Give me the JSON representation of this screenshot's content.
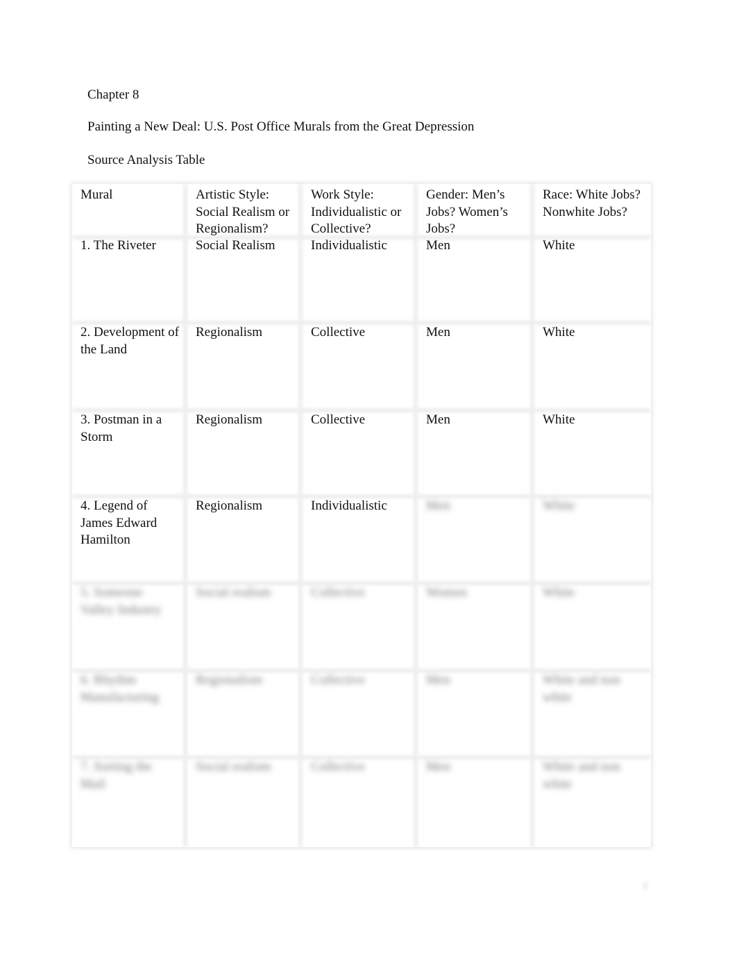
{
  "document": {
    "chapter": "Chapter 8",
    "title": "Painting a New Deal: U.S. Post Office Murals from the Great Depression",
    "subtitle": "Source Analysis Table"
  },
  "table": {
    "headers": [
      "Mural",
      "Artistic Style: Social Realism or Regionalism?",
      "Work Style: Individualistic or Collective?",
      "Gender: Men’s Jobs? Women’s Jobs?",
      "Race: White Jobs? Nonwhite Jobs?"
    ],
    "rows": [
      {
        "mural": "1. The Riveter",
        "artistic": "Social Realism",
        "work": "Individualistic",
        "gender": "Men",
        "race": "White"
      },
      {
        "mural": "2. Development of the Land",
        "artistic": "Regionalism",
        "work": "Collective",
        "gender": "Men",
        "race": "White"
      },
      {
        "mural": "3. Postman in a Storm",
        "artistic": "Regionalism",
        "work": "Collective",
        "gender": "Men",
        "race": "White"
      },
      {
        "mural": "4. Legend of James Edward Hamilton",
        "artistic": "Regionalism",
        "work": "Individualistic",
        "gender": "[obscured]",
        "race": "[obscured]"
      },
      {
        "mural": "[obscured]",
        "artistic": "[obscured]",
        "work": "[obscured]",
        "gender": "[obscured]",
        "race": "[obscured]"
      },
      {
        "mural": "[obscured]",
        "artistic": "[obscured]",
        "work": "[obscured]",
        "gender": "[obscured]",
        "race": "[obscured]"
      },
      {
        "mural": "[obscured]",
        "artistic": "[obscured]",
        "work": "[obscured]",
        "gender": "[obscured]",
        "race": "[obscured]"
      }
    ],
    "blur_placeholders": {
      "r4_gender": "Men",
      "r4_race": "White",
      "r5_mural": "5. Someone Valley Industry",
      "r5_artistic": "Social realism",
      "r5_work": "Collective",
      "r5_gender": "Women",
      "r5_race": "White",
      "r6_mural": "6. Rhythm Manufacturing",
      "r6_artistic": "Regionalism",
      "r6_work": "Collective",
      "r6_gender": "Men",
      "r6_race": "White and non white",
      "r7_mural": "7. Sorting the Mail",
      "r7_artistic": "Social realism",
      "r7_work": "Collective",
      "r7_gender": "Men",
      "r7_race": "White and non white"
    }
  },
  "page_number": "1"
}
